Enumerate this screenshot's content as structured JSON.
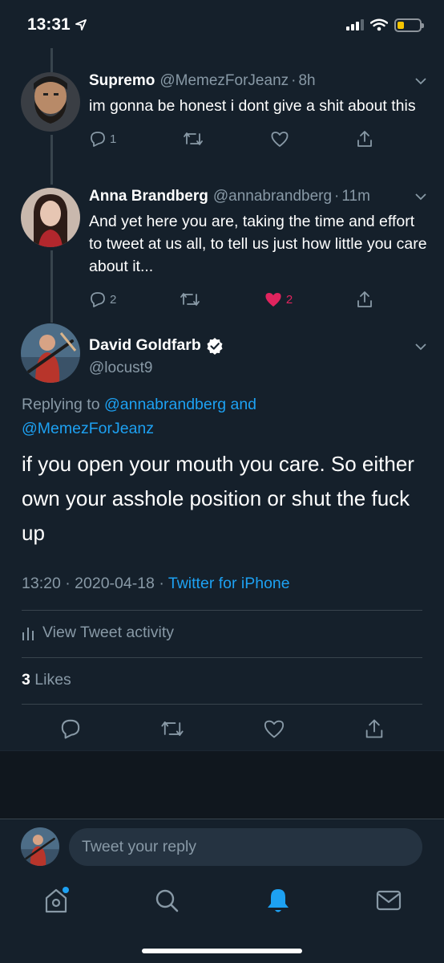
{
  "status_bar": {
    "time": "13:31"
  },
  "thread": [
    {
      "name": "Supremo",
      "handle": "@MemezForJeanz",
      "time": "8h",
      "text": "im gonna be honest i dont give a shit about this",
      "reply_count": "1",
      "retweet_count": "",
      "like_count": "",
      "liked": false
    },
    {
      "name": "Anna Brandberg",
      "handle": "@annabrandberg",
      "time": "11m",
      "text": "And yet here you are, taking the time and effort to tweet at us all, to tell us just how little you care about it...",
      "reply_count": "2",
      "retweet_count": "",
      "like_count": "2",
      "liked": true
    }
  ],
  "main_tweet": {
    "name": "David Goldfarb",
    "handle": "@locust9",
    "replying_prefix": "Replying to",
    "replying_user1": "@annabrandberg",
    "replying_and": "and",
    "replying_user2": "@MemezForJeanz",
    "text": "if you open your mouth you care. So either own your asshole position or shut the fuck up",
    "time": "13:20",
    "date": "2020-04-18",
    "source": "Twitter for iPhone",
    "activity_label": "View Tweet activity",
    "likes_count": "3",
    "likes_label": "Likes"
  },
  "reply_composer": {
    "placeholder": "Tweet your reply"
  },
  "icons": {
    "reply": "reply-icon",
    "retweet": "retweet-icon",
    "like": "heart-icon",
    "share": "share-icon",
    "verified": "verified-badge-icon",
    "home": "home-icon",
    "search": "search-icon",
    "notifications": "bell-icon",
    "messages": "mail-icon"
  },
  "colors": {
    "background": "#15202b",
    "accent": "#1da1f2",
    "like": "#e0245e",
    "muted": "#8899a6",
    "battery": "#f5c400"
  }
}
